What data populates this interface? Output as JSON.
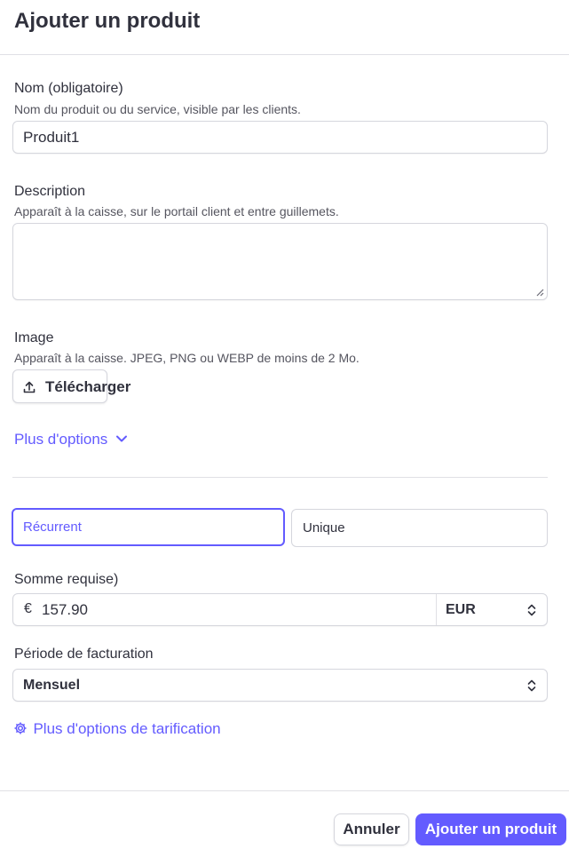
{
  "header": {
    "title": "Ajouter un produit"
  },
  "name_field": {
    "label": "Nom (obligatoire)",
    "hint": "Nom du produit ou du service, visible par les clients.",
    "value": "Produit1"
  },
  "description_field": {
    "label": "Description",
    "hint": "Apparaît à la caisse, sur le portail client et entre guillemets.",
    "value": ""
  },
  "image_field": {
    "label": "Image",
    "hint": "Apparaît à la caisse. JPEG, PNG ou WEBP de moins de 2 Mo.",
    "upload_label": "Télécharger"
  },
  "more_options": {
    "label": "Plus d'options"
  },
  "pricing_type": {
    "options": [
      "Récurrent",
      "Unique"
    ],
    "selected": "Récurrent"
  },
  "amount_field": {
    "label": "Somme requise)",
    "currency_symbol": "€",
    "value": "157.90",
    "currency": "EUR"
  },
  "billing_period": {
    "label": "Période de facturation",
    "value": "Mensuel"
  },
  "more_pricing_options": {
    "label": "Plus d'options de tarification"
  },
  "footer": {
    "cancel_label": "Annuler",
    "submit_label": "Ajouter un produit"
  },
  "colors": {
    "accent": "#635bff",
    "text": "#30313d",
    "border": "#d5d6dd"
  }
}
